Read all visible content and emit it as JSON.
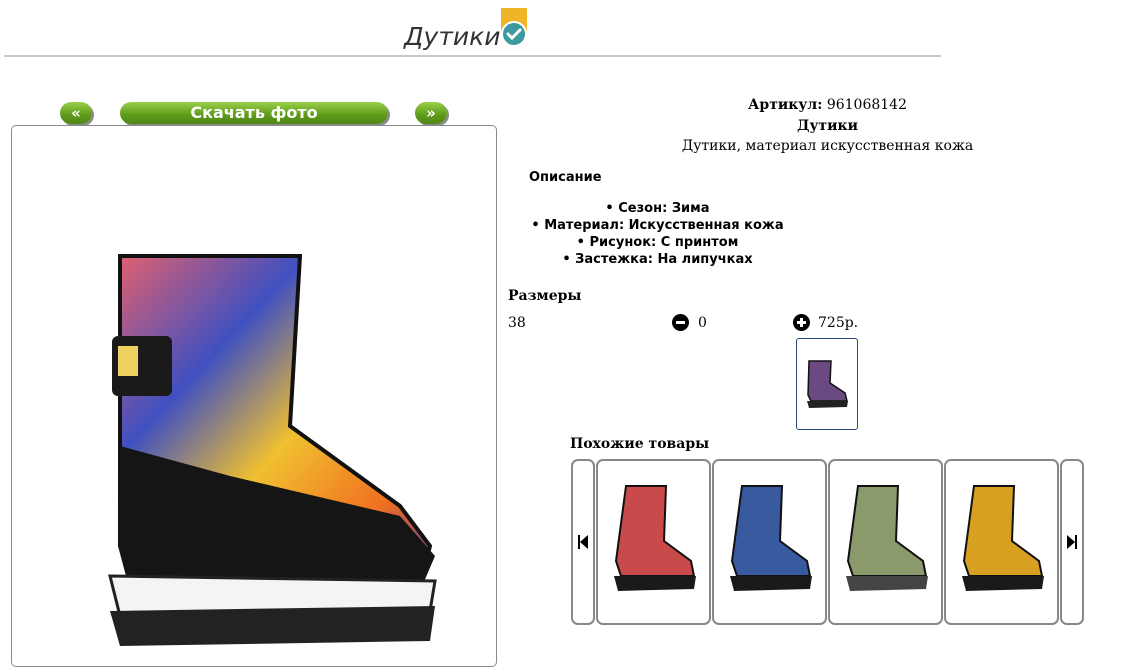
{
  "header": {
    "title": "Дутики",
    "badge_icon": "check-badge-icon"
  },
  "photo_nav": {
    "prev_label": "«",
    "download_label": "Скачать фото",
    "next_label": "»"
  },
  "product": {
    "article_label": "Артикул:",
    "article_value": "961068142",
    "name": "Дутики",
    "description": "Дутики, материал искусственная кожа",
    "description_heading": "Описание",
    "properties": [
      "Сезон: Зима",
      "Материал: Искусственная кожа",
      "Рисунок: С принтом",
      "Застежка: На липучках"
    ]
  },
  "sizes": {
    "heading": "Размеры",
    "rows": [
      {
        "size": "38",
        "quantity": "0",
        "price": "725р."
      }
    ]
  },
  "similar": {
    "heading": "Похожие товары",
    "prev_icon": "skip-back-icon",
    "next_icon": "skip-forward-icon",
    "cards": [
      {
        "color": "#c84a4a"
      },
      {
        "color": "#3a5aa0"
      },
      {
        "color": "#8a9a6a"
      },
      {
        "color": "#d8a020"
      }
    ]
  },
  "colors": {
    "green_button": "#5e9a1a",
    "thumb_border": "#2a4a7a"
  }
}
